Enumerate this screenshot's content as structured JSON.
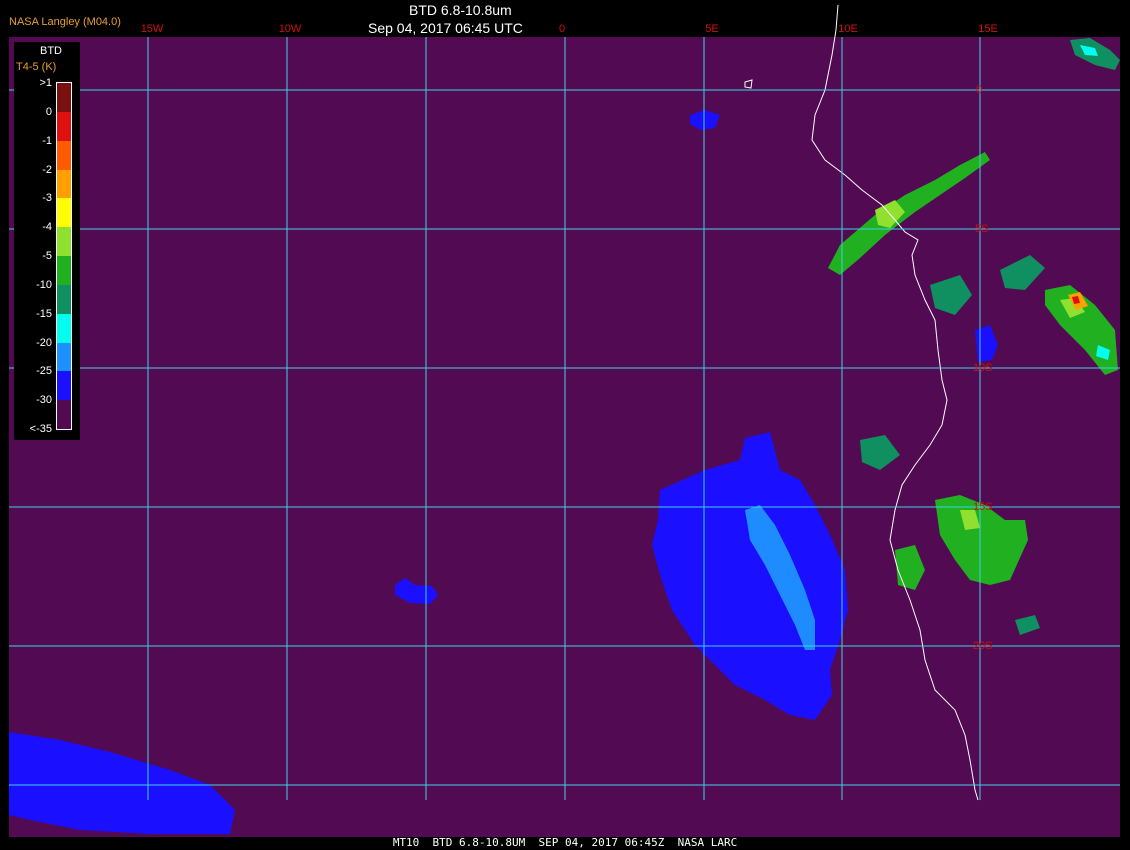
{
  "header": {
    "title": "BTD 6.8-10.8um",
    "datetime": "Sep 04, 2017 06:45 UTC",
    "credit": "NASA Langley (M04.0)"
  },
  "footer": {
    "text": "MT10  BTD 6.8-10.8UM  SEP 04, 2017 06:45Z  NASA LARC"
  },
  "legend": {
    "title": "BTD",
    "subtitle": "T4-5 (K)",
    "ticks": [
      ">1",
      "0",
      "-1",
      "-2",
      "-3",
      "-4",
      "-5",
      "-10",
      "-15",
      "-20",
      "-25",
      "-30",
      "<-35"
    ],
    "colors": [
      "#7a1010",
      "#e01010",
      "#ff5a00",
      "#ffa000",
      "#ffff00",
      "#90e030",
      "#20b020",
      "#109060",
      "#00ffee",
      "#1e90ff",
      "#1a10ff",
      "#520a52"
    ]
  },
  "grid": {
    "lon_labels": [
      "15W",
      "10W",
      "0",
      "5E",
      "10E",
      "15E"
    ],
    "lat_labels": [
      "0",
      "5S",
      "10S",
      "15S",
      "20S"
    ]
  },
  "colors": {
    "background": "#520a52",
    "grid": "#40d0e8",
    "coastline": "#ffffff",
    "label_red": "#d01010"
  }
}
